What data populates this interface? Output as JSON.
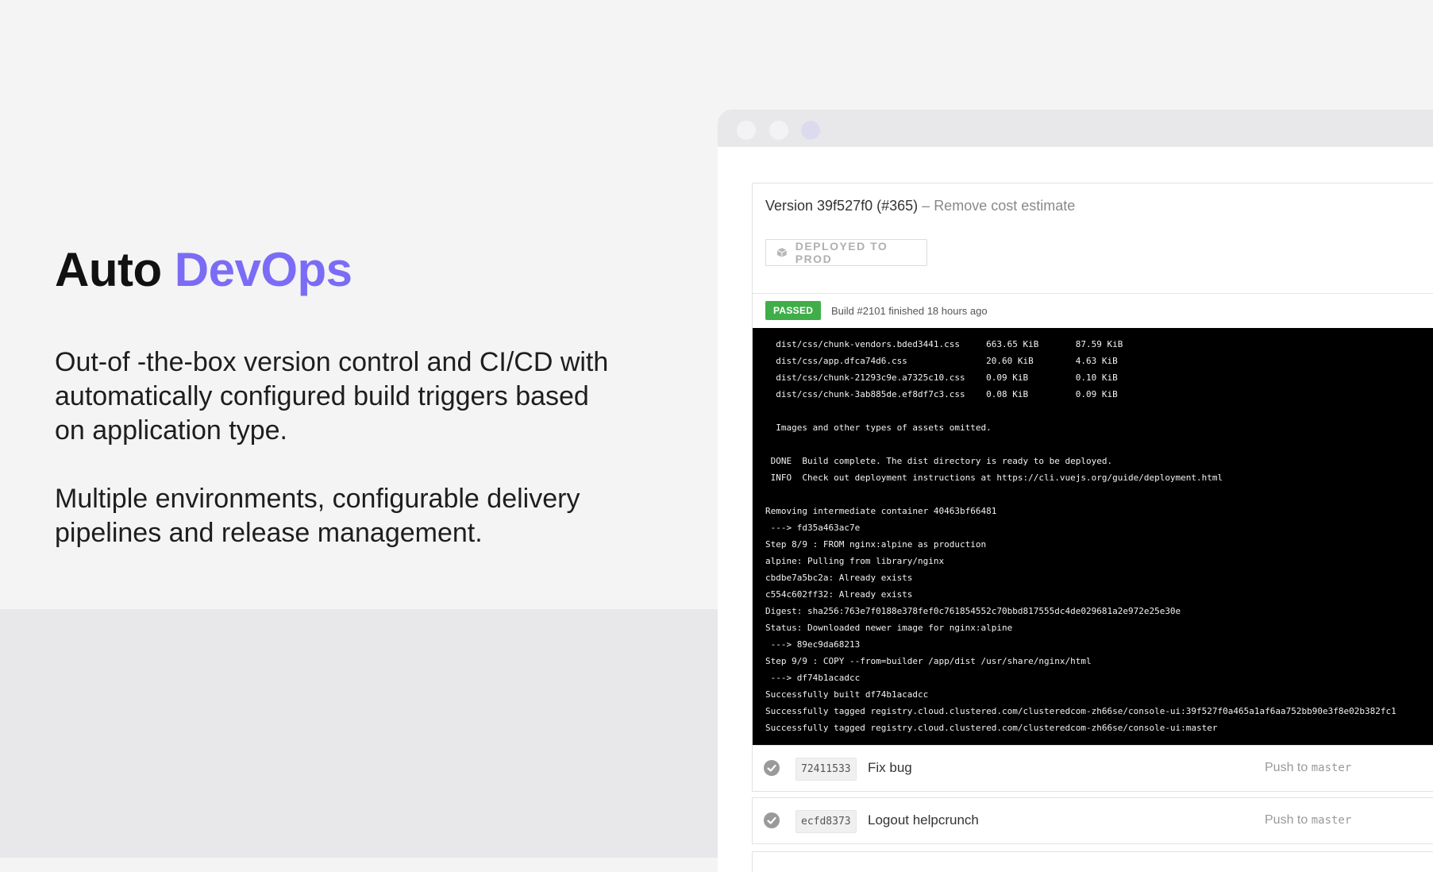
{
  "hero": {
    "title_plain": "Auto",
    "title_accent": "DevOps",
    "paragraph1": "Out-of -the-box version control and CI/CD with automatically configured build triggers based on application type.",
    "paragraph2": "Multiple environments, configurable delivery pipelines and release management."
  },
  "colors": {
    "accent": "#7b6cf6",
    "passed": "#3fae49",
    "log_bg": "#000000"
  },
  "version": {
    "label": "Version 39f527f0 (#365)",
    "separator": "–",
    "message": "Remove cost estimate",
    "deploy_button": "DEPLOYED TO PROD",
    "deploy_icon": "cube-icon"
  },
  "build": {
    "status": "PASSED",
    "text": "Build #2101 finished 18 hours ago"
  },
  "log_lines": [
    "  dist/css/chunk-vendors.bded3441.css     663.65 KiB       87.59 KiB",
    "  dist/css/app.dfca74d6.css               20.60 KiB        4.63 KiB",
    "  dist/css/chunk-21293c9e.a7325c10.css    0.09 KiB         0.10 KiB",
    "  dist/css/chunk-3ab885de.ef8df7c3.css    0.08 KiB         0.09 KiB",
    "",
    "  Images and other types of assets omitted.",
    "",
    " DONE  Build complete. The dist directory is ready to be deployed.",
    " INFO  Check out deployment instructions at https://cli.vuejs.org/guide/deployment.html",
    "",
    "Removing intermediate container 40463bf66481",
    " ---> fd35a463ac7e",
    "Step 8/9 : FROM nginx:alpine as production",
    "alpine: Pulling from library/nginx",
    "cbdbe7a5bc2a: Already exists",
    "c554c602ff32: Already exists",
    "Digest: sha256:763e7f0188e378fef0c761854552c70bbd817555dc4de029681a2e972e25e30e",
    "Status: Downloaded newer image for nginx:alpine",
    " ---> 89ec9da68213",
    "Step 9/9 : COPY --from=builder /app/dist /usr/share/nginx/html",
    " ---> df74b1acadcc",
    "Successfully built df74b1acadcc",
    "Successfully tagged registry.cloud.clustered.com/clusteredcom-zh66se/console-ui:39f527f0a465a1af6aa752bb90e3f8e02b382fc1",
    "Successfully tagged registry.cloud.clustered.com/clusteredcom-zh66se/console-ui:master"
  ],
  "commits": [
    {
      "sha": "72411533",
      "message": "Fix bug",
      "push_label": "Push to",
      "branch": "master"
    },
    {
      "sha": "ecfd8373",
      "message": "Logout helpcrunch",
      "push_label": "Push to",
      "branch": "master"
    }
  ]
}
